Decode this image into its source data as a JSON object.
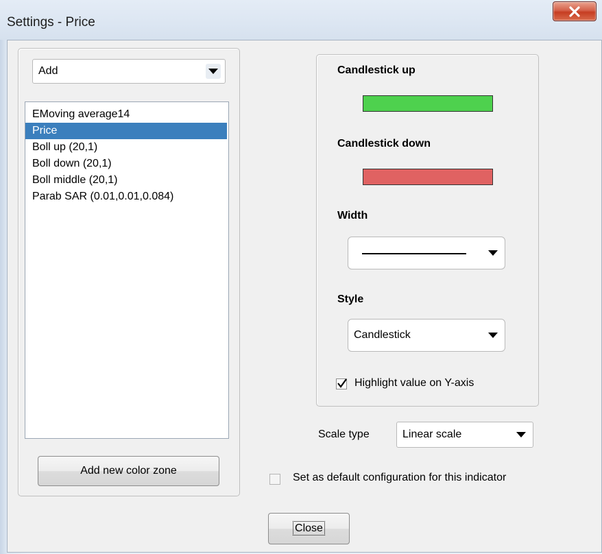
{
  "window": {
    "title": "Settings - Price"
  },
  "left_panel": {
    "add_dropdown": {
      "value": "Add"
    },
    "indicators": [
      {
        "label": "EMoving average14",
        "selected": false
      },
      {
        "label": "Price",
        "selected": true
      },
      {
        "label": "Boll up (20,1)",
        "selected": false
      },
      {
        "label": "Boll down (20,1)",
        "selected": false
      },
      {
        "label": "Boll middle (20,1)",
        "selected": false
      },
      {
        "label": "Parab SAR (0.01,0.01,0.084)",
        "selected": false
      }
    ],
    "add_zone_button": "Add new color zone"
  },
  "right_panel": {
    "candle_up_label": "Candlestick up",
    "candle_up_color": "#4ed14e",
    "candle_down_label": "Candlestick down",
    "candle_down_color": "#e06262",
    "width_label": "Width",
    "style_label": "Style",
    "style_value": "Candlestick",
    "highlight_label": "Highlight value on Y-axis",
    "highlight_checked": true
  },
  "scale": {
    "label": "Scale type",
    "value": "Linear scale"
  },
  "default_config": {
    "label": "Set as default configuration for this indicator",
    "checked": false
  },
  "close_button": "Close",
  "icons": {
    "title_close": "close-icon",
    "dropdown": "chevron-down-icon",
    "check": "checkmark-icon"
  }
}
